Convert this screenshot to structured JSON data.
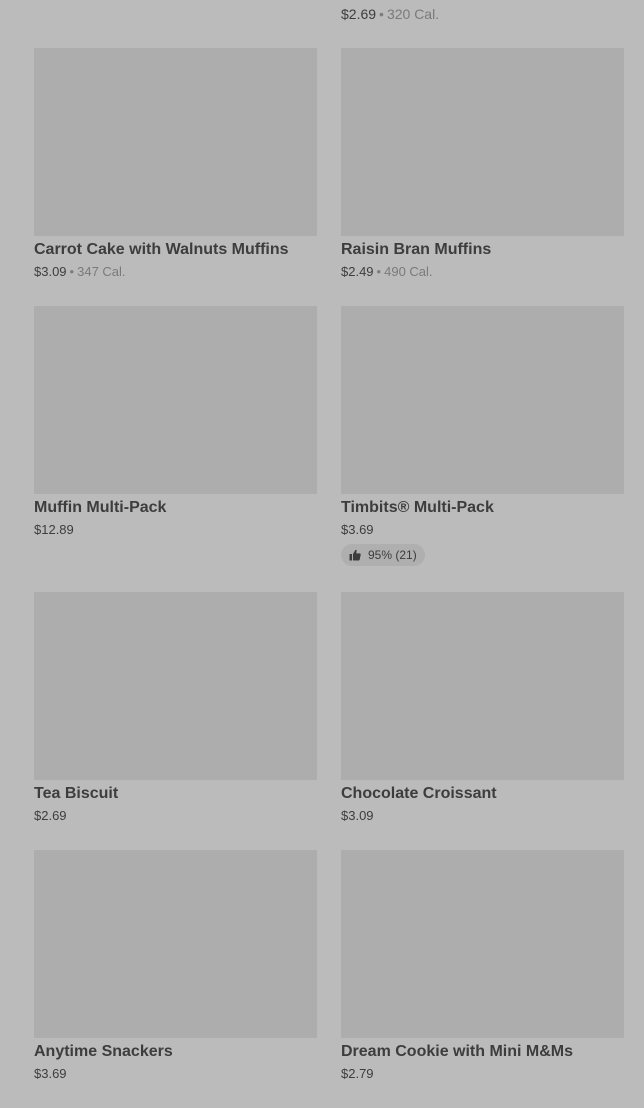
{
  "top": {
    "prev_title": "",
    "right_price": "$2.69",
    "right_cal": "320 Cal."
  },
  "items": [
    {
      "name": "Carrot Cake with Walnuts Muffins",
      "price": "$3.09",
      "cal": "347 Cal."
    },
    {
      "name": "Raisin Bran Muffins",
      "price": "$2.49",
      "cal": "490 Cal."
    },
    {
      "name": "Muffin Multi-Pack",
      "price": "$12.89",
      "cal": ""
    },
    {
      "name": "Timbits® Multi-Pack",
      "price": "$3.69",
      "cal": "",
      "rating": "95% (21)"
    },
    {
      "name": "Tea Biscuit",
      "price": "$2.69",
      "cal": ""
    },
    {
      "name": "Chocolate Croissant",
      "price": "$3.09",
      "cal": ""
    },
    {
      "name": "Anytime Snackers",
      "price": "$3.69",
      "cal": ""
    },
    {
      "name": "Dream Cookie with Mini M&Ms",
      "price": "$2.79",
      "cal": ""
    }
  ]
}
